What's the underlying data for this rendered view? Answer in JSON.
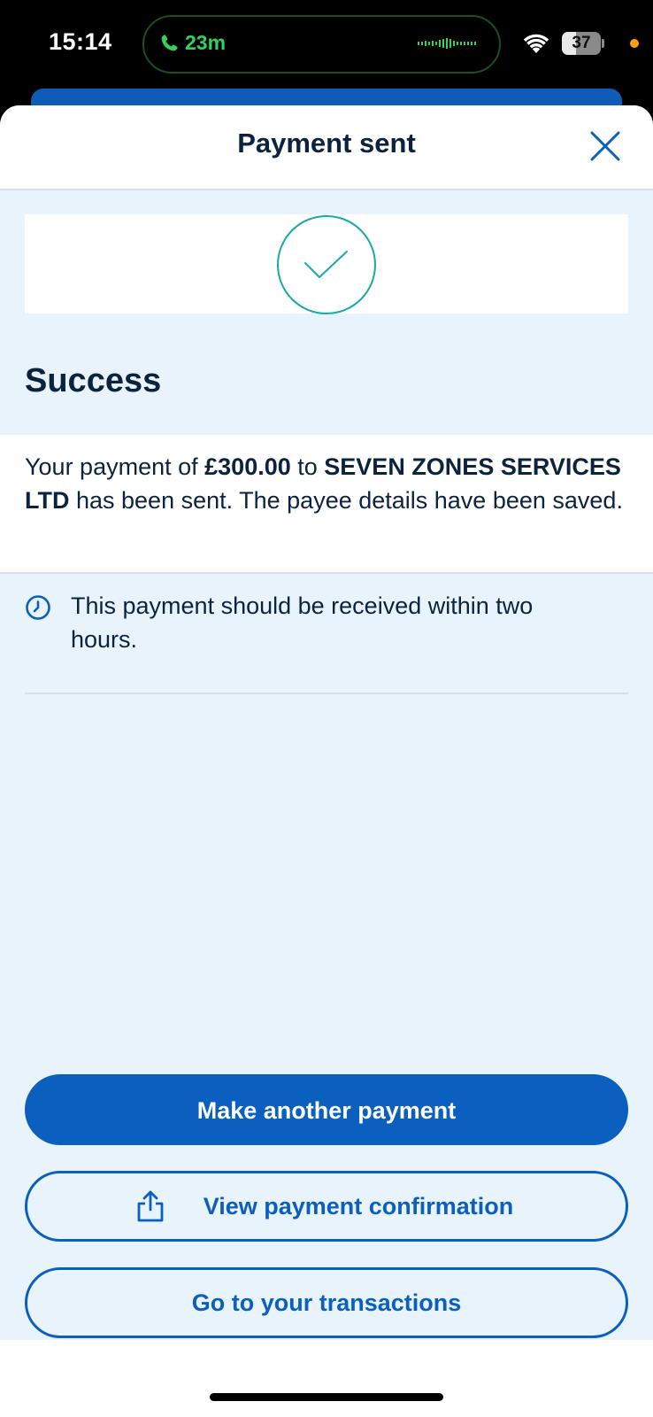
{
  "status_bar": {
    "time": "15:14",
    "call_duration": "23m",
    "battery_level": "37",
    "battery_fraction": 0.37,
    "icons": [
      "phone-icon",
      "waveform-icon",
      "wifi-icon",
      "battery-icon",
      "privacy-indicator-dot"
    ]
  },
  "sheet": {
    "title": "Payment sent",
    "close_icon": "close-icon"
  },
  "status": {
    "icon": "checkmark-circle-icon",
    "title": "Success"
  },
  "message": {
    "prefix": "Your payment of ",
    "amount": "£300.00",
    "middle": " to ",
    "payee": "SEVEN ZONES SERVICES LTD",
    "suffix": " has been sent. The payee details have been saved."
  },
  "info": {
    "icon": "clock-icon",
    "text": "This payment should be received within two hours."
  },
  "actions": {
    "make_another": "Make another payment",
    "view_confirmation": "View payment confirmation",
    "view_confirmation_icon": "share-icon",
    "transactions": "Go to your transactions"
  },
  "colors": {
    "primary": "#0b5fbf",
    "text_dark": "#0c2340",
    "sheet_background": "#e8f3fc",
    "success_teal": "#1aa8a8",
    "call_green": "#34d158"
  }
}
